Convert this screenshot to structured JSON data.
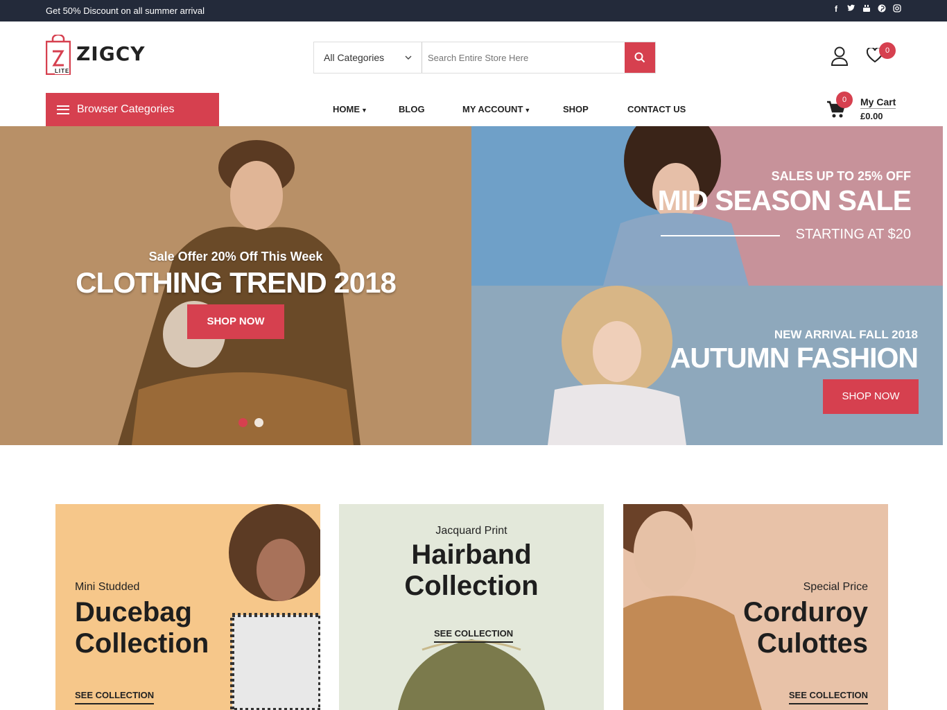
{
  "topbar": {
    "promo_text": "Get 50% Discount on all summer arrival",
    "social_icons": [
      "facebook-icon",
      "twitter-icon",
      "youtube-icon",
      "pinterest-icon",
      "instagram-icon"
    ]
  },
  "logo": {
    "name": "ZIGCY",
    "sub": "LITE"
  },
  "search": {
    "category": "All Categories",
    "placeholder": "Search Entire Store Here"
  },
  "header": {
    "wishlist_count": "0",
    "cart_count": "0",
    "cart_label": "My Cart",
    "cart_total": "£0.00"
  },
  "nav": {
    "categories_button": "Browser Categories",
    "items": [
      "HOME",
      "BLOG",
      "MY ACCOUNT",
      "SHOP",
      "CONTACT US"
    ]
  },
  "hero": {
    "kicker": "Sale Offer 20% Off This Week",
    "title": "CLOTHING TREND 2018",
    "button": "SHOP NOW",
    "slides": 2,
    "active_slide": 1
  },
  "banner_top": {
    "kicker": "SALES UP TO 25% OFF",
    "title": "MID SEASON SALE",
    "sub": "STARTING AT $20"
  },
  "banner_bottom": {
    "kicker": "NEW ARRIVAL FALL 2018",
    "title": "AUTUMN FASHION",
    "button": "SHOP NOW"
  },
  "promos": [
    {
      "kicker": "Mini Studded",
      "title1": "Ducebag",
      "title2": "Collection",
      "link": "SEE COLLECTION"
    },
    {
      "kicker": "Jacquard Print",
      "title1": "Hairband",
      "title2": "Collection",
      "link": "SEE COLLECTION"
    },
    {
      "kicker": "Special Price",
      "title1": "Corduroy",
      "title2": "Culottes",
      "link": "SEE COLLECTION"
    }
  ],
  "colors": {
    "accent": "#d6404f",
    "topbar": "#232a3a"
  }
}
